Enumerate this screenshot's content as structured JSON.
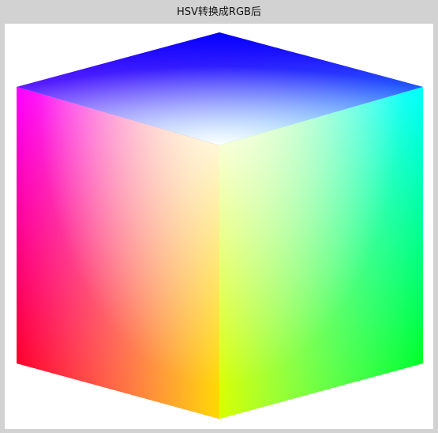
{
  "window": {
    "title": "HSV转换成RGB后"
  },
  "cube": {
    "corner_colors": {
      "top": "#0000ff",
      "top_left": "#ff00ff",
      "top_right": "#00ffff",
      "center": "#ffffff",
      "bottom_left": "#ff0000",
      "bottom": "#ffff00",
      "bottom_right": "#00ff00"
    }
  }
}
